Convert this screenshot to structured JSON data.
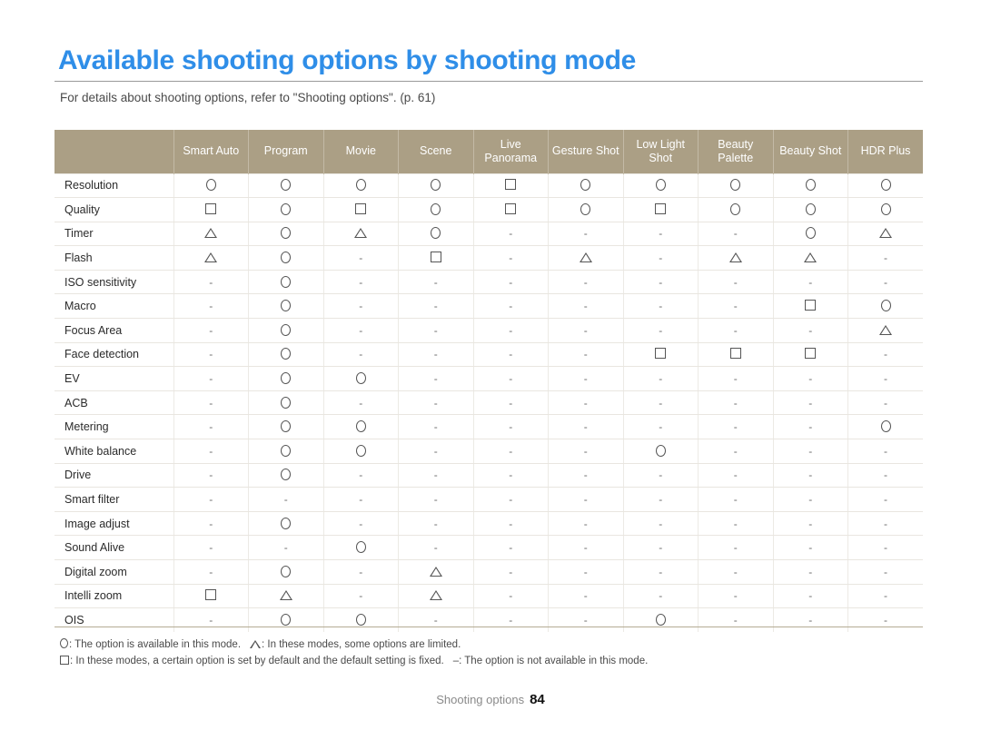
{
  "document": {
    "title": "Available shooting options by shooting mode",
    "subtitle": "For details about shooting options, refer to \"Shooting options\". (p. 61)",
    "title_color": "#2f8ee8",
    "header_bg_color": "#ab9f85"
  },
  "table": {
    "corner_header": "",
    "columns": [
      "Smart Auto",
      "Program",
      "Movie",
      "Scene",
      "Live Panorama",
      "Gesture Shot",
      "Low Light Shot",
      "Beauty Palette",
      "Beauty Shot",
      "HDR Plus"
    ],
    "rows": [
      {
        "label": "Resolution",
        "cells": [
          "O",
          "O",
          "O",
          "O",
          "SQ",
          "O",
          "O",
          "O",
          "O",
          "O"
        ]
      },
      {
        "label": "Quality",
        "cells": [
          "SQ",
          "O",
          "SQ",
          "O",
          "SQ",
          "O",
          "SQ",
          "O",
          "O",
          "O"
        ]
      },
      {
        "label": "Timer",
        "cells": [
          "TRI",
          "O",
          "TRI",
          "O",
          "-",
          "-",
          "-",
          "-",
          "O",
          "TRI"
        ]
      },
      {
        "label": "Flash",
        "cells": [
          "TRI",
          "O",
          "-",
          "SQ",
          "-",
          "TRI",
          "-",
          "TRI",
          "TRI",
          "-"
        ]
      },
      {
        "label": "ISO sensitivity",
        "cells": [
          "-",
          "O",
          "-",
          "-",
          "-",
          "-",
          "-",
          "-",
          "-",
          "-"
        ]
      },
      {
        "label": "Macro",
        "cells": [
          "-",
          "O",
          "-",
          "-",
          "-",
          "-",
          "-",
          "-",
          "SQ",
          "O"
        ]
      },
      {
        "label": "Focus Area",
        "cells": [
          "-",
          "O",
          "-",
          "-",
          "-",
          "-",
          "-",
          "-",
          "-",
          "TRI"
        ]
      },
      {
        "label": "Face detection",
        "cells": [
          "-",
          "O",
          "-",
          "-",
          "-",
          "-",
          "SQ",
          "SQ",
          "SQ",
          "-"
        ]
      },
      {
        "label": "EV",
        "cells": [
          "-",
          "O",
          "O",
          "-",
          "-",
          "-",
          "-",
          "-",
          "-",
          "-"
        ]
      },
      {
        "label": "ACB",
        "cells": [
          "-",
          "O",
          "-",
          "-",
          "-",
          "-",
          "-",
          "-",
          "-",
          "-"
        ]
      },
      {
        "label": "Metering",
        "cells": [
          "-",
          "O",
          "O",
          "-",
          "-",
          "-",
          "-",
          "-",
          "-",
          "O"
        ]
      },
      {
        "label": "White balance",
        "cells": [
          "-",
          "O",
          "O",
          "-",
          "-",
          "-",
          "O",
          "-",
          "-",
          "-"
        ]
      },
      {
        "label": "Drive",
        "cells": [
          "-",
          "O",
          "-",
          "-",
          "-",
          "-",
          "-",
          "-",
          "-",
          "-"
        ]
      },
      {
        "label": "Smart filter",
        "cells": [
          "-",
          "-",
          "-",
          "-",
          "-",
          "-",
          "-",
          "-",
          "-",
          "-"
        ]
      },
      {
        "label": "Image adjust",
        "cells": [
          "-",
          "O",
          "-",
          "-",
          "-",
          "-",
          "-",
          "-",
          "-",
          "-"
        ]
      },
      {
        "label": "Sound Alive",
        "cells": [
          "-",
          "-",
          "O",
          "-",
          "-",
          "-",
          "-",
          "-",
          "-",
          "-"
        ]
      },
      {
        "label": "Digital zoom",
        "cells": [
          "-",
          "O",
          "-",
          "TRI",
          "-",
          "-",
          "-",
          "-",
          "-",
          "-"
        ]
      },
      {
        "label": "Intelli zoom",
        "cells": [
          "SQ",
          "TRI",
          "-",
          "TRI",
          "-",
          "-",
          "-",
          "-",
          "-",
          "-"
        ]
      },
      {
        "label": "OIS",
        "cells": [
          "-",
          "O",
          "O",
          "-",
          "-",
          "-",
          "O",
          "-",
          "-",
          "-"
        ]
      }
    ]
  },
  "legend": {
    "line1_circle": ": The option is available in this mode.",
    "line1_triangle": ": In these modes, some options are limited.",
    "line2_square": ": In these modes, a certain option is set by default and the default setting is fixed.",
    "line2_dash": "–: The option is not available in this mode."
  },
  "footer": {
    "section": "Shooting options",
    "page": "84"
  }
}
